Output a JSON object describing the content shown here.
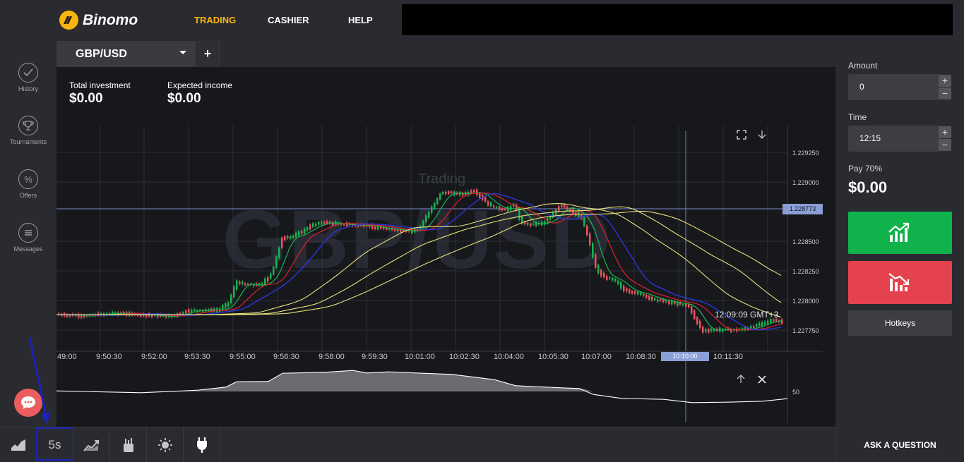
{
  "brand": {
    "name": "Binomo"
  },
  "nav": {
    "trading": "TRADING",
    "cashier": "CASHIER",
    "help": "HELP"
  },
  "sidebar": {
    "items": [
      {
        "label": "History",
        "icon": "check-circle-icon"
      },
      {
        "label": "Tournaments",
        "icon": "trophy-icon"
      },
      {
        "label": "Offers",
        "icon": "percent-icon"
      },
      {
        "label": "Messages",
        "icon": "messages-icon"
      }
    ]
  },
  "tabs": {
    "active": "GBP/USD",
    "add": "+"
  },
  "investment": {
    "total_label": "Total investment",
    "total_value": "$0.00",
    "expected_label": "Expected income",
    "expected_value": "$0.00"
  },
  "chart": {
    "mode_label": "Trading",
    "watermark": "GBP/USD",
    "current_price": "1.228773",
    "server_time": "12:09:09 GMT+3",
    "cursor_time": "10:10:00",
    "price_ticks": [
      "1.229250",
      "1.229000",
      "1.228500",
      "1.228250",
      "1.228000",
      "1.227750"
    ],
    "time_ticks": [
      ":49:00",
      "9:50:30",
      "9:52:00",
      "9:53:30",
      "9:55:00",
      "9:56:30",
      "9:58:00",
      "9:59:30",
      "10:01:00",
      "10:02:30",
      "10:04:00",
      "10:05:30",
      "10:07:00",
      "10:08:30",
      "10:11:30"
    ],
    "indicator_level": "50",
    "colors": {
      "up": "#19b34f",
      "down": "#e8535e",
      "ma_red": "#e0202a",
      "ma_blue": "#2a36d8",
      "ma_yellow": "#e8e07a"
    }
  },
  "panel": {
    "amount_label": "Amount",
    "amount_value": "0",
    "time_label": "Time",
    "time_value": "12:15",
    "pay_label": "Pay 70%",
    "pay_value": "$0.00",
    "hotkeys": "Hotkeys",
    "plus": "+",
    "minus": "−"
  },
  "bottom": {
    "timeframe": "5s",
    "ask": "ASK A QUESTION"
  }
}
